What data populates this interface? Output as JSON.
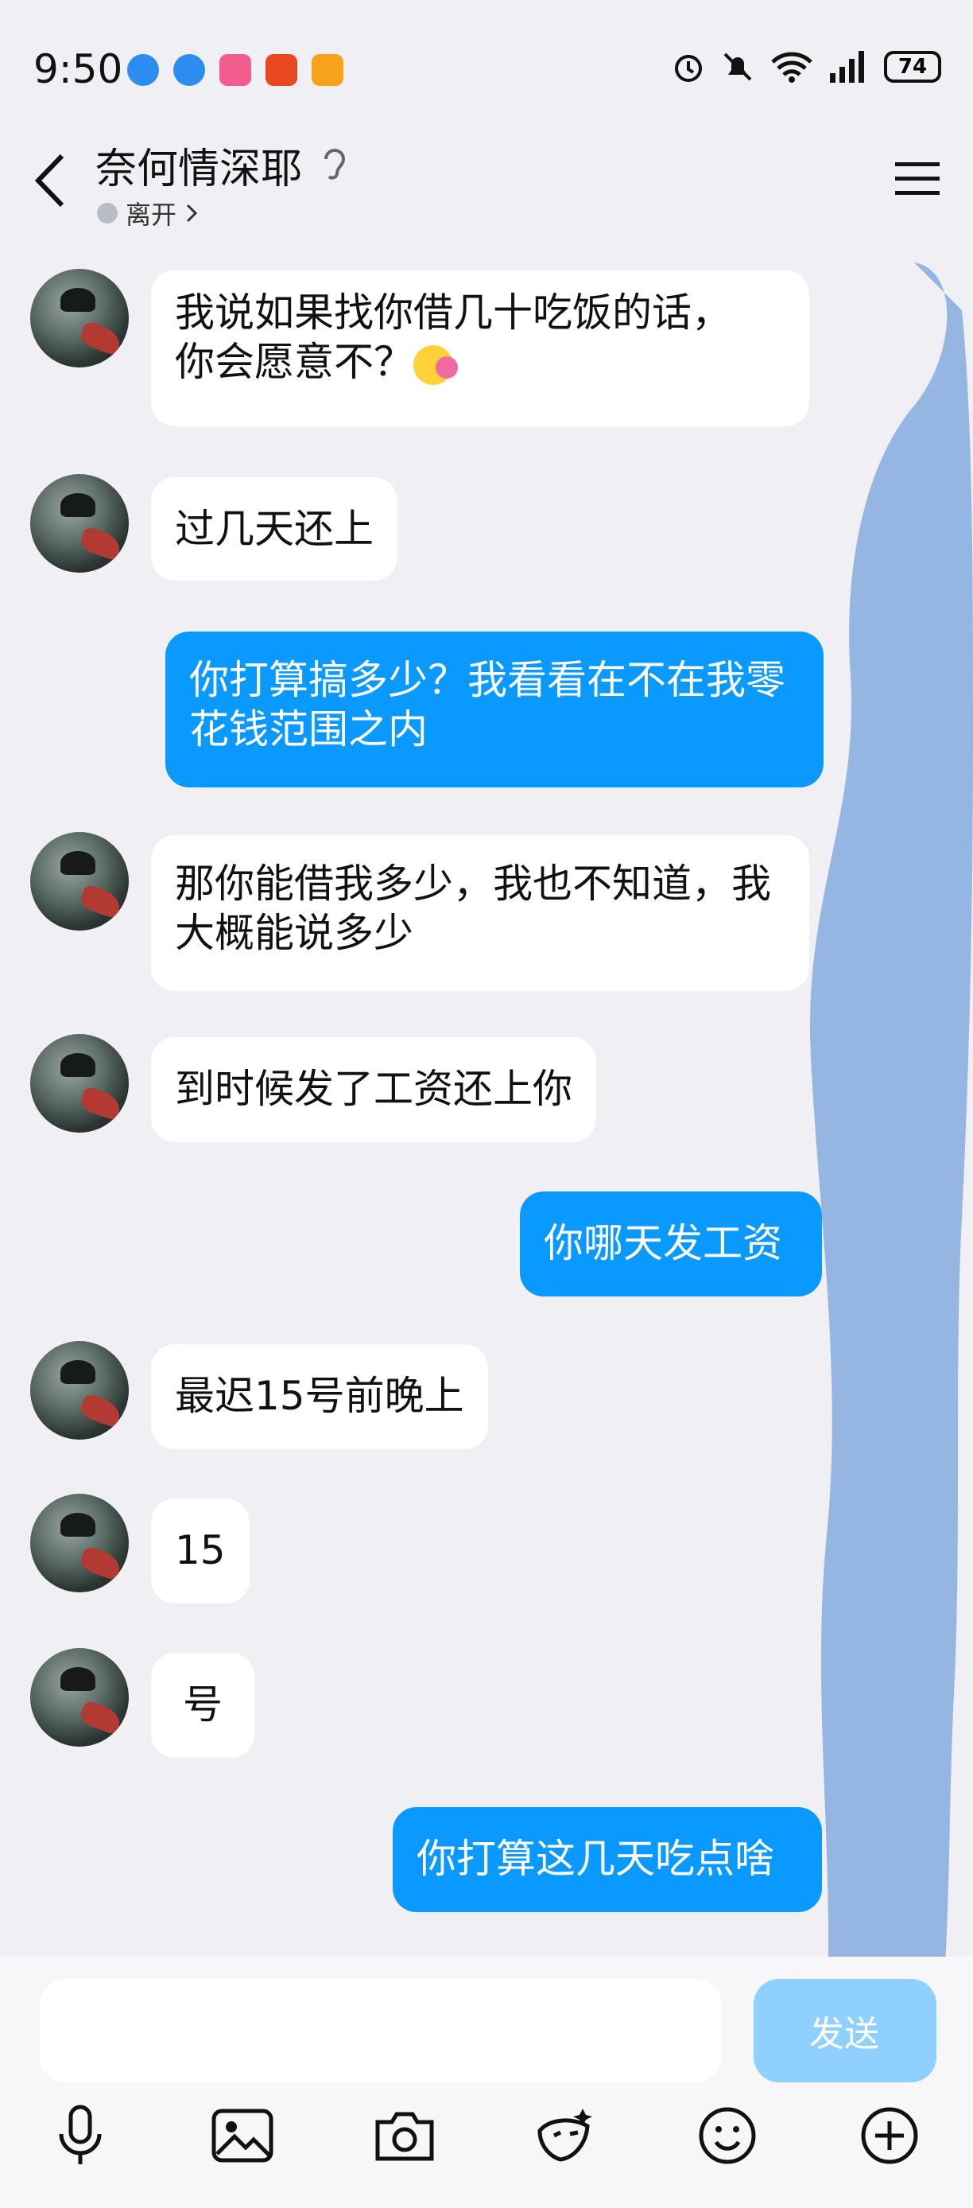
{
  "status": {
    "time": "9:50",
    "battery": "74"
  },
  "header": {
    "title": "奈何情深耶",
    "presence": "离开"
  },
  "messages": [
    {
      "side": "in",
      "text": "我说如果找你借几十吃饭的话，\n你会愿意不？"
    },
    {
      "side": "in",
      "text": "过几天还上"
    },
    {
      "side": "out",
      "text": "你打算搞多少？我看看在不在我零花钱范围之内"
    },
    {
      "side": "in",
      "text": "那你能借我多少，我也不知道，我大概能说多少"
    },
    {
      "side": "in",
      "text": "到时候发了工资还上你"
    },
    {
      "side": "out",
      "text": "你哪天发工资"
    },
    {
      "side": "in",
      "text": "最迟15号前晚上"
    },
    {
      "side": "in",
      "text": "15"
    },
    {
      "side": "in",
      "text": "号"
    },
    {
      "side": "out",
      "text": "你打算这几天吃点啥"
    }
  ],
  "input": {
    "placeholder": "",
    "send_label": "发送"
  },
  "colors": {
    "out_bubble": "#0a99ff",
    "in_bubble": "#ffffff",
    "background": "#f0eff3",
    "scribble": "#8fb2e0"
  },
  "icons": [
    "mic-icon",
    "image-icon",
    "camera-icon",
    "sticker-icon",
    "emoji-icon",
    "plus-icon"
  ]
}
